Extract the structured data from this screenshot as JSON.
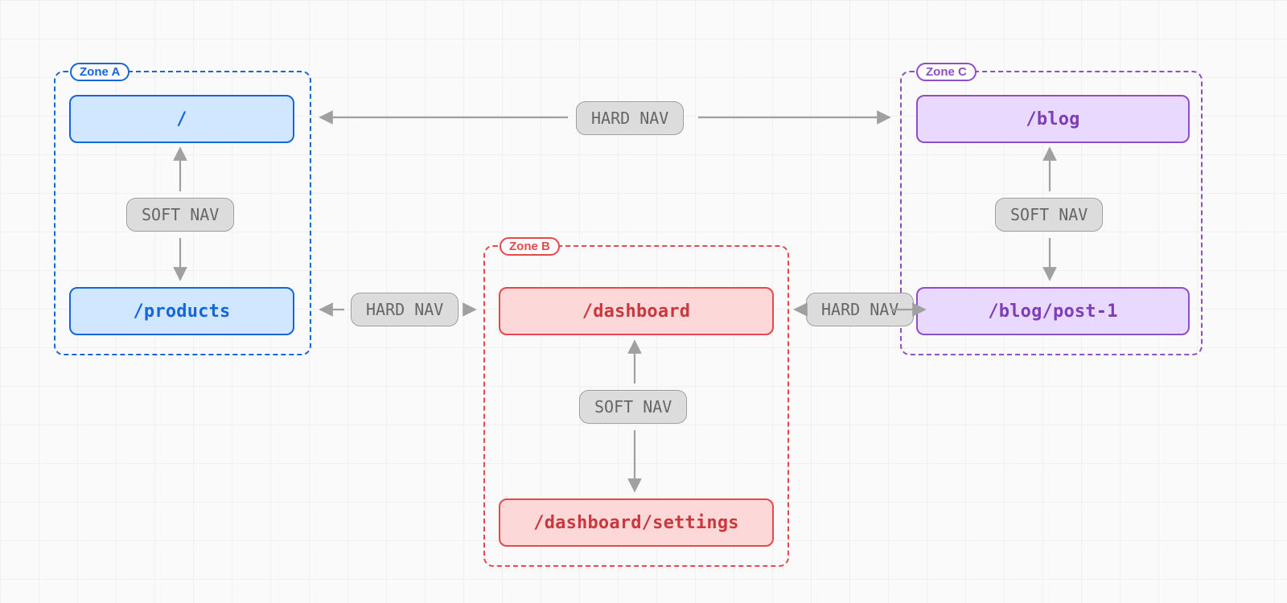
{
  "zones": {
    "a": {
      "label": "Zone A",
      "routes": [
        "/",
        "/products"
      ],
      "inner_nav": "SOFT NAV",
      "color": "#1566d6"
    },
    "b": {
      "label": "Zone B",
      "routes": [
        "/dashboard",
        "/dashboard/settings"
      ],
      "inner_nav": "SOFT NAV",
      "color": "#e5484d"
    },
    "c": {
      "label": "Zone C",
      "routes": [
        "/blog",
        "/blog/post-1"
      ],
      "inner_nav": "SOFT NAV",
      "color": "#8e4ec6"
    }
  },
  "edges": {
    "a_to_c": "HARD NAV",
    "a_to_b": "HARD NAV",
    "b_to_c": "HARD NAV"
  }
}
